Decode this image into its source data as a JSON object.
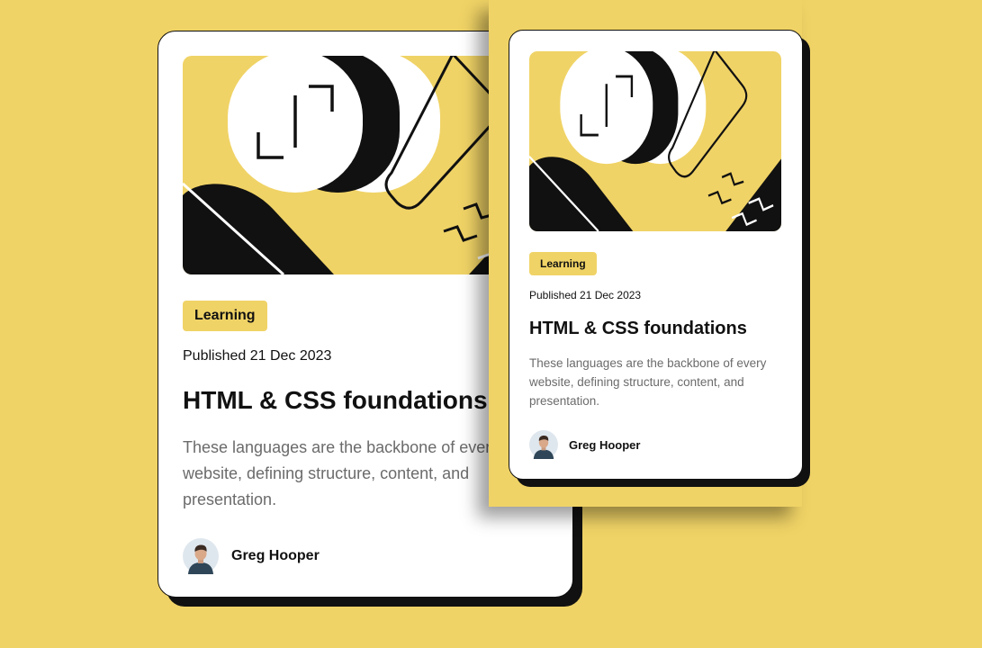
{
  "colors": {
    "background": "#f0d366",
    "card": "#ffffff",
    "ink": "#111111",
    "muted_text": "#6b6b6b",
    "tag_background": "#f0d366"
  },
  "card": {
    "tag": "Learning",
    "published": "Published 21 Dec 2023",
    "title": "HTML & CSS foundations",
    "description": "These languages are the backbone of every website, defining structure, content, and presentation.",
    "author": {
      "name": "Greg Hooper",
      "avatar_icon": "person-avatar-icon"
    },
    "illustration_icon": "abstract-illustration-icon"
  }
}
